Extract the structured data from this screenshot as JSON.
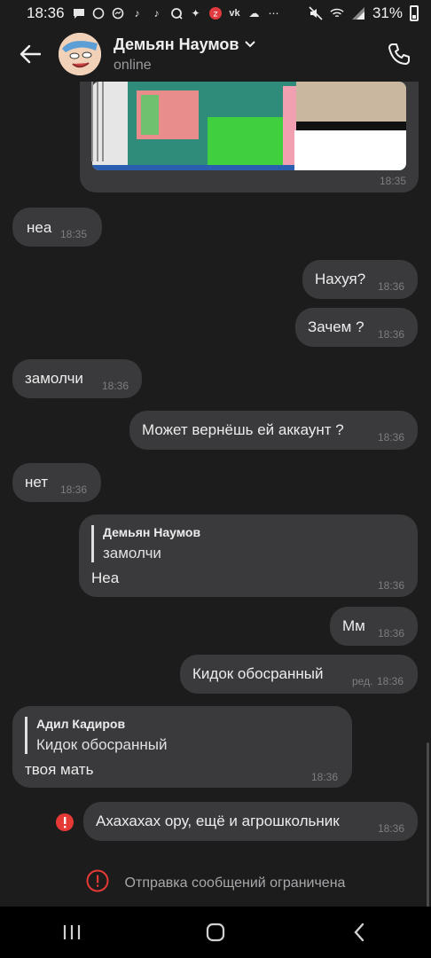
{
  "status_bar": {
    "time": "18:36",
    "battery": "31%",
    "notification_icons": [
      "message-icon",
      "whatsapp-icon",
      "messenger-icon",
      "tiktok-icon",
      "tiktok-icon",
      "qiwi-icon",
      "sparkle-icon",
      "notification-badge-icon",
      "vk-icon",
      "weather-icon",
      "more-icon"
    ],
    "system_icons": [
      "mute-icon",
      "wifi-icon",
      "signal-icon",
      "battery-icon"
    ]
  },
  "header": {
    "contact_name": "Демьян Наумов",
    "status": "online"
  },
  "messages": [
    {
      "type": "media",
      "side": "out",
      "time": "18:35"
    },
    {
      "side": "in",
      "text": "неа",
      "time": "18:35"
    },
    {
      "side": "out",
      "text": "Нахуя?",
      "time": "18:36"
    },
    {
      "side": "out",
      "text": "Зачем ?",
      "time": "18:36"
    },
    {
      "side": "in",
      "text": "замолчи",
      "time": "18:36"
    },
    {
      "side": "out",
      "text": "Может вернёшь ей аккаунт ?",
      "time": "18:36"
    },
    {
      "side": "in",
      "text": "нет",
      "time": "18:36"
    },
    {
      "side": "out",
      "reply_name": "Демьян Наумов",
      "reply_text": "замолчи",
      "text": "Неа",
      "time": "18:36"
    },
    {
      "side": "out",
      "text": "Мм",
      "time": "18:36"
    },
    {
      "side": "out",
      "text": "Кидок обосранный",
      "edited": "ред.",
      "time": "18:36"
    },
    {
      "side": "in",
      "reply_name": "Адил Кадиров",
      "reply_text": "Кидок обосранный",
      "text": "твоя мать",
      "time": "18:36"
    },
    {
      "side": "out",
      "text": "Ахахахах ору, ещё и агрошкольник",
      "time": "18:36",
      "error": true
    }
  ],
  "restriction_notice": "Отправка сообщений ограничена",
  "colors": {
    "background": "#1c1c1d",
    "bubble": "#3a3a3c",
    "error": "#e53935"
  }
}
